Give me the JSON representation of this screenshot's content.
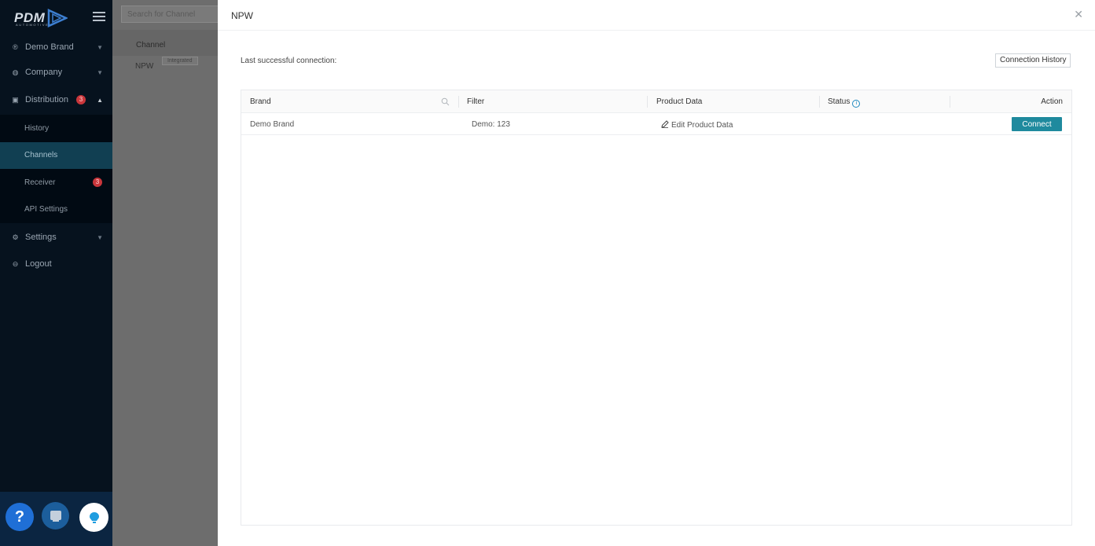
{
  "logo": {
    "main": "PDM",
    "sub": "AUTOMOTIVE"
  },
  "sidebar": {
    "items": [
      {
        "label": "Demo Brand",
        "icon": "registered-icon"
      },
      {
        "label": "Company",
        "icon": "globe-icon"
      },
      {
        "label": "Distribution",
        "icon": "distribution-icon",
        "badge": "3"
      },
      {
        "label": "Settings",
        "icon": "gear-icon"
      },
      {
        "label": "Logout",
        "icon": "logout-icon"
      }
    ],
    "sub_items": [
      {
        "label": "History"
      },
      {
        "label": "Channels"
      },
      {
        "label": "Receiver",
        "badge": "3"
      },
      {
        "label": "API Settings"
      }
    ]
  },
  "background": {
    "search_placeholder": "Search for Channel",
    "column_header": "Channel",
    "row_name": "NPW",
    "row_tag": "Integrated"
  },
  "drawer": {
    "title": "NPW",
    "last_connection_label": "Last successful connection:",
    "connection_history_label": "Connection History",
    "table": {
      "headers": {
        "brand": "Brand",
        "filter": "Filter",
        "product_data": "Product Data",
        "status": "Status",
        "action": "Action"
      },
      "rows": [
        {
          "brand": "Demo Brand",
          "filter": "Demo: 123",
          "product_data": "Edit Product Data",
          "status": "",
          "action": "Connect"
        }
      ]
    }
  },
  "colors": {
    "sidebar_bg": "#06121e",
    "active_item": "#113f52",
    "accent": "#1f8a9e",
    "badge": "#c9363b"
  }
}
